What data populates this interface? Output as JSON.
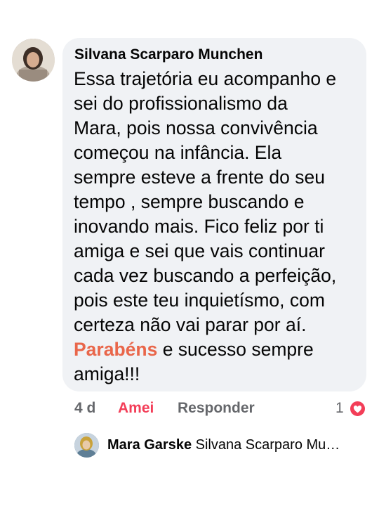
{
  "comment": {
    "author": "Silvana Scarparo Munchen",
    "lines": [
      "Essa trajetória eu acompanho e",
      "sei do profissionalismo da",
      "Mara, pois nossa convivência",
      "começou na infância. Ela",
      "sempre esteve a frente do seu",
      "tempo , sempre buscando e",
      "inovando mais. Fico feliz por ti",
      "amiga e sei que vais continuar",
      "cada vez buscando a perfeição,",
      "pois este teu inquietísmo, com",
      "certeza não vai parar por aí."
    ],
    "hashtag": "Parabéns",
    "after_hashtag": " e sucesso sempre",
    "last_line": "amiga!!!"
  },
  "actions": {
    "time": "4 d",
    "like_label": "Amei",
    "reply_label": "Responder",
    "reaction_count": "1",
    "reaction_icon": "heart-icon",
    "like_color": "#f33e58",
    "hashtag_color": "#e9664a"
  },
  "reply": {
    "author": "Mara Garske",
    "preview": "Silvana Scarparo Mu…"
  }
}
